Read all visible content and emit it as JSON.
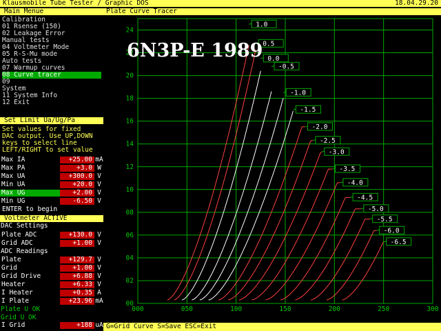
{
  "title_bar": {
    "app_title": "Klausmobile Tube Tester / Graphic DOS",
    "date": "18.04.29.20"
  },
  "menu": {
    "header": "Main Menue",
    "items": [
      {
        "label": "Calibration",
        "selected": false
      },
      {
        "label": " 01 Rsense (150)",
        "selected": false
      },
      {
        "label": " 02 Leakage Error",
        "selected": false
      },
      {
        "label": "Manual tests",
        "selected": false
      },
      {
        "label": " 04 Voltmeter Mode",
        "selected": false
      },
      {
        "label": " 05 R-S-Mu mode",
        "selected": false
      },
      {
        "label": "Auto tests",
        "selected": false
      },
      {
        "label": " 07 Warmup curves",
        "selected": false
      },
      {
        "label": " 08 Curve tracer",
        "selected": true
      },
      {
        "label": " 09",
        "selected": false
      },
      {
        "label": "System",
        "selected": false
      },
      {
        "label": " 11 System Info",
        "selected": false
      },
      {
        "label": " 12 Exit",
        "selected": false
      }
    ]
  },
  "set_limit": {
    "header": "Set Limit Ua/Ug/Pa",
    "help": [
      "Set values for fixed",
      "DAC output. Use UP,DOWN",
      "keys to select line",
      "LEFT/RIGHT to set value"
    ],
    "rows": [
      {
        "label": "Max IA",
        "value": "+25.00",
        "unit": "mA",
        "selected": false
      },
      {
        "label": "Max PA",
        "value": "+3.0",
        "unit": "W",
        "selected": false
      },
      {
        "label": "Max UA",
        "value": "+300.0",
        "unit": "V",
        "selected": false
      },
      {
        "label": "Min UA",
        "value": "+20.0",
        "unit": "V",
        "selected": false
      },
      {
        "label": "Max UG",
        "value": "+2.00",
        "unit": "V",
        "selected": true
      },
      {
        "label": "Min UG",
        "value": "-6.50",
        "unit": "V",
        "selected": false
      }
    ],
    "enter_hint": "ENTER to begin"
  },
  "voltmeter": {
    "header": "Voltmeter ACTIVE",
    "dac_header": "DAC Settings",
    "dac_rows": [
      {
        "label": "Plate ADC",
        "value": "+130.0",
        "unit": "V"
      },
      {
        "label": "Grid ADC",
        "value": "+1.00",
        "unit": "V"
      }
    ],
    "adc_header": "ADC Readings",
    "adc_rows": [
      {
        "label": "Plate",
        "value": "+129.7",
        "unit": "V"
      },
      {
        "label": "Grid",
        "value": "+1.00",
        "unit": "V"
      },
      {
        "label": "Grid Drive",
        "value": "+6.88",
        "unit": "V"
      },
      {
        "label": "Heater",
        "value": "+6.33",
        "unit": "V"
      },
      {
        "label": "I Heater",
        "value": "+0.35",
        "unit": "A"
      },
      {
        "label": "I Plate",
        "value": "+23.96",
        "unit": "mA"
      }
    ],
    "status": [
      "Plate U OK",
      "Grid U OK"
    ],
    "igrid": {
      "label": "I Grid",
      "value": "+188",
      "unit": "uA"
    }
  },
  "plot": {
    "header": "Plate Curve Tracer",
    "footer": "G=Grid Curve S=Save ESC=Exit",
    "tube_label": "6N3P-E 1989"
  },
  "colors": {
    "bar": "#ffff55",
    "grid": "#00aa00",
    "curve_red": "#ff4040",
    "curve_white": "#ffffff",
    "value_bg": "#c00000",
    "selected": "#00aa00"
  },
  "chart_data": {
    "type": "line",
    "title": "6N3P-E 1989",
    "x_ticks": [
      "000",
      "050",
      "100",
      "150",
      "200",
      "250",
      "300"
    ],
    "y_ticks": [
      "00",
      "02",
      "04",
      "06",
      "08",
      "10",
      "12",
      "14",
      "16",
      "18",
      "20",
      "22",
      "24"
    ],
    "xlim": [
      0,
      300
    ],
    "ylim": [
      0,
      25
    ],
    "grid": true,
    "series": [
      {
        "name": "1.0",
        "ug": 1.0,
        "start_ua": 30,
        "ua_at_24": 117
      },
      {
        "name": "0.5",
        "ug": 0.5,
        "start_ua": 37,
        "ua_at_24": 125
      },
      {
        "name": "0.0",
        "ug": 0.0,
        "start_ua": 45,
        "ua_at_24": 135
      },
      {
        "name": "-0.5",
        "ug": -0.5,
        "start_ua": 55,
        "ua_at_24": 152
      },
      {
        "name": "-1.0",
        "ug": -1.0,
        "start_ua": 63,
        "ua_at_24": 167
      },
      {
        "name": "-1.5",
        "ug": -1.5,
        "start_ua": 72,
        "ua_at_24": 182
      },
      {
        "name": "-2.0",
        "ug": -2.0,
        "start_ua": 82,
        "ua_at_24": 197
      },
      {
        "name": "-2.5",
        "ug": -2.5,
        "start_ua": 92,
        "ua_at_24": 212
      },
      {
        "name": "-3.0",
        "ug": -3.0,
        "start_ua": 103,
        "ua_at_24": 228
      },
      {
        "name": "-3.5",
        "ug": -3.5,
        "start_ua": 116,
        "ua_at_24": 243
      },
      {
        "name": "-4.0",
        "ug": -4.0,
        "start_ua": 130,
        "ua_at_24": 258
      },
      {
        "name": "-4.5",
        "ug": -4.5,
        "start_ua": 145,
        "ua_at_24": 272
      },
      {
        "name": "-5.0",
        "ug": -5.0,
        "start_ua": 160,
        "ua_at_24": 287
      },
      {
        "name": "-5.5",
        "ug": -5.5,
        "start_ua": 176,
        "ua_at_24": 300
      },
      {
        "name": "-6.0",
        "ug": -6.0,
        "start_ua": 192,
        "ua_at_24": 312
      },
      {
        "name": "-6.5",
        "ug": -6.5,
        "start_ua": 208,
        "ua_at_24": 325
      }
    ],
    "curve_ends": [
      {
        "name": "1.0",
        "ua": 113,
        "ia": 24.5
      },
      {
        "name": "0.5",
        "ua": 120,
        "ia": 22.8
      },
      {
        "name": "0.0",
        "ua": 125,
        "ia": 21.5
      },
      {
        "name": "-0.5",
        "ua": 136,
        "ia": 20.8
      },
      {
        "name": "-1.0",
        "ua": 148,
        "ia": 18.5
      },
      {
        "name": "-1.5",
        "ug": -1.5,
        "ua": 158,
        "ia": 17.0
      },
      {
        "name": "-2.0",
        "ua": 170,
        "ia": 15.5
      },
      {
        "name": "-2.5",
        "ua": 178,
        "ia": 14.3
      },
      {
        "name": "-3.0",
        "ua": 187,
        "ia": 13.3
      },
      {
        "name": "-3.5",
        "ua": 198,
        "ia": 11.8
      },
      {
        "name": "-4.0",
        "ua": 206,
        "ia": 10.6
      },
      {
        "name": "-4.5",
        "ua": 216,
        "ia": 9.3
      },
      {
        "name": "-5.0",
        "ua": 227,
        "ia": 8.3
      },
      {
        "name": "-5.5",
        "ua": 236,
        "ia": 7.4
      },
      {
        "name": "-6.0",
        "ua": 243,
        "ia": 6.4
      },
      {
        "name": "-6.5",
        "ua": 250,
        "ia": 5.4
      }
    ]
  }
}
